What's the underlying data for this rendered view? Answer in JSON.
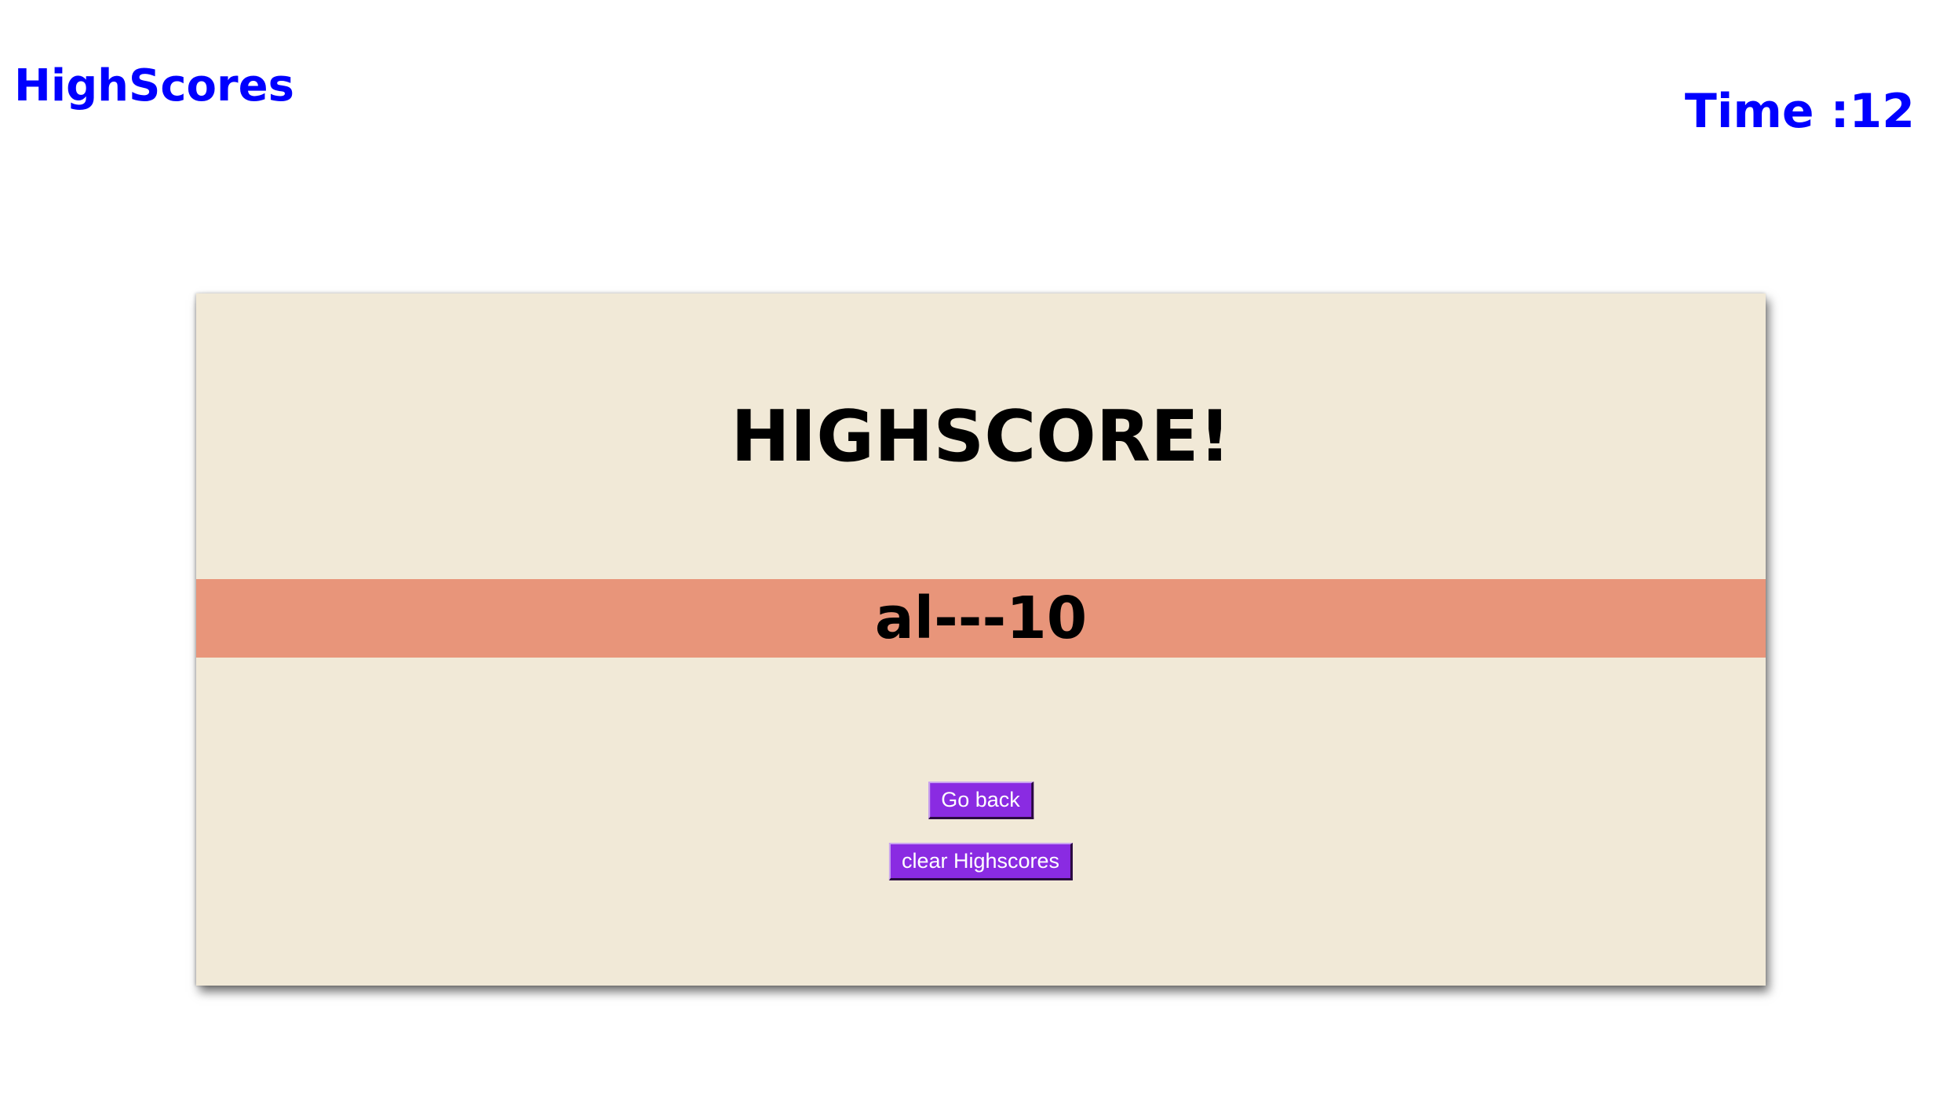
{
  "header": {
    "highscores_link": "HighScores",
    "timer_label": "Time :",
    "timer_value": "12"
  },
  "card": {
    "title": "HIGHSCORE!",
    "scores": [
      "al---10"
    ],
    "go_back_label": "Go back",
    "clear_label": "clear Highscores"
  },
  "colors": {
    "link": "#0000ff",
    "card_background": "#f1e9d7",
    "score_band": "#e8957a",
    "button": "#8a2be2"
  }
}
